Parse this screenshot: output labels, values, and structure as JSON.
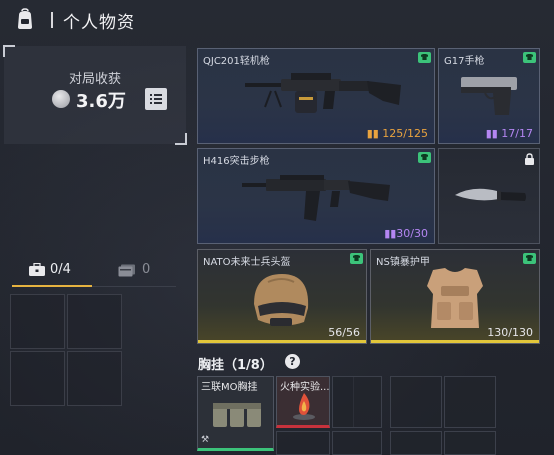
{
  "header": {
    "title": "个人物资"
  },
  "income": {
    "label": "对局收获",
    "value": "3.6万"
  },
  "tabs": [
    {
      "label": "0/4"
    },
    {
      "label": "0"
    }
  ],
  "weapons": {
    "primary": {
      "name": "QJC201轻机枪",
      "ammo": "125/125"
    },
    "pistol": {
      "name": "G17手枪",
      "ammo": "17/17"
    },
    "secondary": {
      "name": "H416突击步枪",
      "ammo": "30/30"
    },
    "melee": {
      "name": ""
    }
  },
  "armor": {
    "helmet": {
      "name": "NATO未来士兵头盔",
      "durability": "56/56",
      "durability_fraction": 1.0
    },
    "vest": {
      "name": "NS镇暴护甲",
      "durability": "130/130",
      "durability_fraction": 1.0
    }
  },
  "chest_rig": {
    "title": "胸挂（1/8）",
    "items": [
      {
        "name": "三联MO胸挂"
      },
      {
        "name": "火种实验..."
      }
    ]
  },
  "colors": {
    "accent_gold": "#e6b340",
    "rarity_green": "#3cc37a",
    "ammo_orange": "#e9a33f",
    "ammo_purple": "#b486f2",
    "rarity_red": "#c8323c"
  }
}
